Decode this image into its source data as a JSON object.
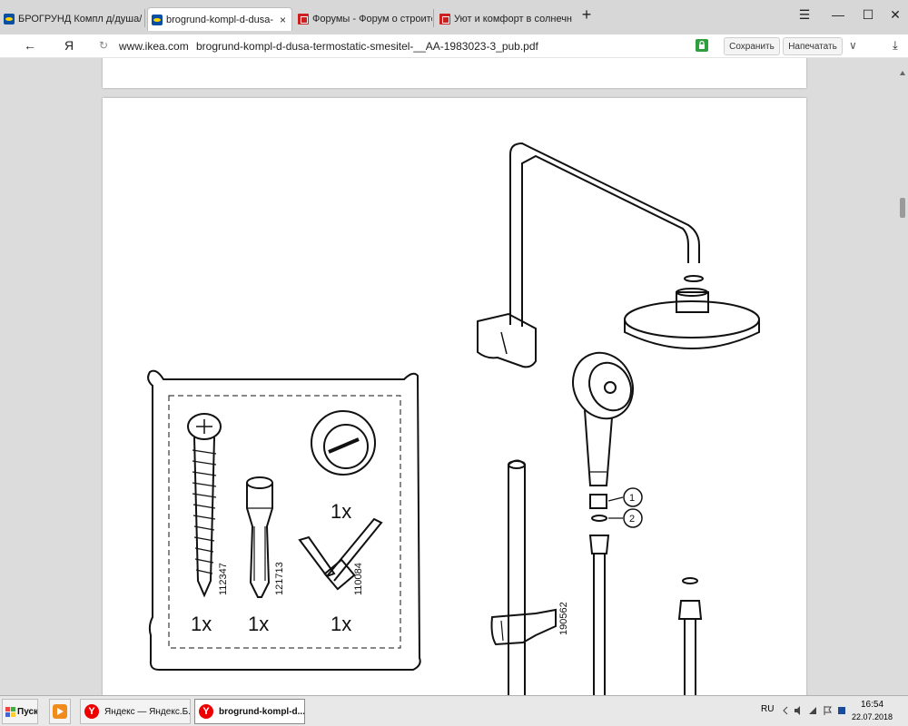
{
  "tabs": [
    {
      "label": "БРОГРУНД Компл д/душа/",
      "favicon": "ikea-icon",
      "active": false
    },
    {
      "label": "brogrund-kompl-d-dusa-",
      "favicon": "ikea-icon",
      "active": true
    },
    {
      "label": "Форумы - Форум о строите",
      "favicon": "forum-icon",
      "active": false
    },
    {
      "label": "Уют и комфорт в солнечно",
      "favicon": "forum-icon",
      "active": false
    }
  ],
  "tab_close_glyph": "×",
  "new_tab_glyph": "+",
  "window_controls": {
    "menu": "☰",
    "minimize": "—",
    "maximize": "☐",
    "close": "✕"
  },
  "nav": {
    "back_glyph": "←",
    "yandex_glyph": "Я",
    "reload_glyph": "↻"
  },
  "address": {
    "domain": "www.ikea.com",
    "path": "brogrund-kompl-d-dusa-termostatic-smesitel-__AA-1983023-3_pub.pdf"
  },
  "actions": {
    "save": "Сохранить",
    "print": "Напечатать",
    "dropdown_glyph": "∨",
    "download_glyph": "⤓"
  },
  "document": {
    "part_ids": [
      "112347",
      "121713",
      "110084",
      "190562"
    ],
    "quantities": [
      "1x",
      "1x",
      "1x",
      "1x"
    ],
    "callouts": [
      "1",
      "2"
    ]
  },
  "taskbar": {
    "start_label": "Пуск",
    "items": [
      {
        "label": "Яндекс — Яндекс.Б...",
        "active": false
      },
      {
        "label": "brogrund-kompl-d...",
        "active": true
      }
    ],
    "lang": "RU",
    "time": "16:54",
    "date": "22.07.2018"
  },
  "colors": {
    "tabbar_bg": "#d7d7d7",
    "url_domain": "#3c8c3c",
    "lock": "#2e9e3e",
    "viewer_bg": "#dcdcdc",
    "yandex_red": "#e00000"
  }
}
